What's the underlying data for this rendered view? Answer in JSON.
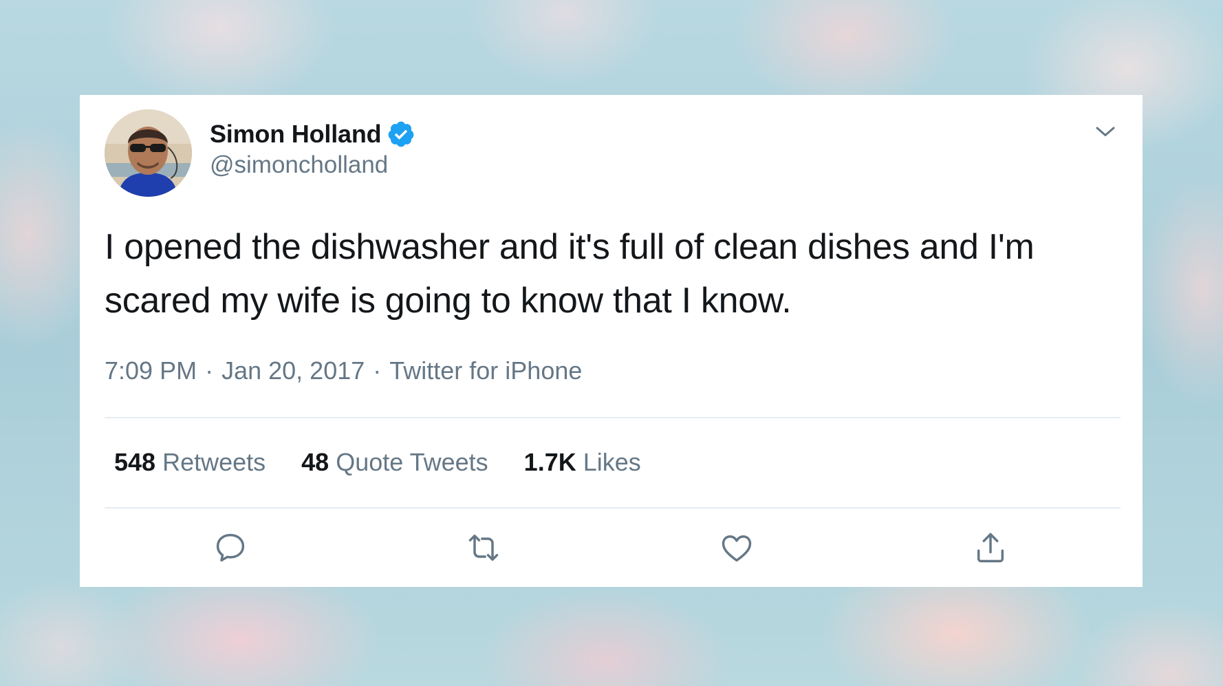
{
  "tweet": {
    "author": {
      "display_name": "Simon Holland",
      "handle": "@simoncholland",
      "verified": true
    },
    "text": "I opened the dishwasher and it's full of clean dishes and I'm scared my wife is going to know that I know.",
    "time": "7:09 PM",
    "date": "Jan 20, 2017",
    "source": "Twitter for iPhone",
    "separator": "·",
    "stats": {
      "retweets": {
        "count": "548",
        "label": "Retweets"
      },
      "quote_tweets": {
        "count": "48",
        "label": "Quote Tweets"
      },
      "likes": {
        "count": "1.7K",
        "label": "Likes"
      }
    },
    "actions": [
      "reply-icon",
      "retweet-icon",
      "like-icon",
      "share-icon"
    ]
  },
  "colors": {
    "text_primary": "#14171a",
    "text_secondary": "#657786",
    "verified_blue": "#1da1f2",
    "divider": "#e6ecf0",
    "card_background": "#ffffff"
  }
}
